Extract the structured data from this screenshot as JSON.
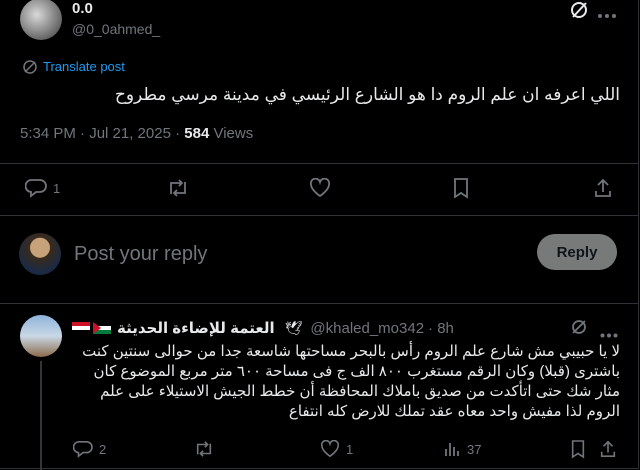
{
  "post": {
    "display_name": "0.0",
    "handle": "@0_0ahmed_",
    "translate_label": "Translate post",
    "text": "اللي اعرفه ان علم الروم دا هو الشارع الرئيسي في مدينة مرسي مطروح",
    "time": "5:34 PM · Jul 21, 2025 ·",
    "views_count": "584",
    "views_label": "Views",
    "reply_count": "1",
    "icons": [
      "grok-icon",
      "reply-icon",
      "repost-icon",
      "like-icon",
      "bookmark-icon",
      "share-icon"
    ]
  },
  "composer": {
    "placeholder": "Post your reply",
    "reply_button": "Reply"
  },
  "reply": {
    "display_name": "العتمة للإضاءة الحديثة",
    "handle": "@khaled_mo342",
    "time": "· 8h",
    "text": "لا يا حبيبي مش شارع علم الروم رأس بالبحر مساحتها شاسعة جدا من حوالى سنتين كنت باشترى (قبلا) وكان الرقم مستغرب ٨٠٠ الف ج فى مساحة ٦٠٠ متر مربع الموضوع كان مثار شك حتى اتأكدت من صديق باملاك المحافظة أن خطط الجيش الاستيلاء على علم الروم لذا مفيش واحد معاه عقد تملك للارض كله انتفاع",
    "reply_count": "2",
    "like_count": "1",
    "views_count": "37",
    "flag_colors": {
      "egypt_red": "#ce1126",
      "egypt_black": "#000000",
      "pal_green": "#007a3d",
      "pal_red": "#ce1126"
    }
  }
}
